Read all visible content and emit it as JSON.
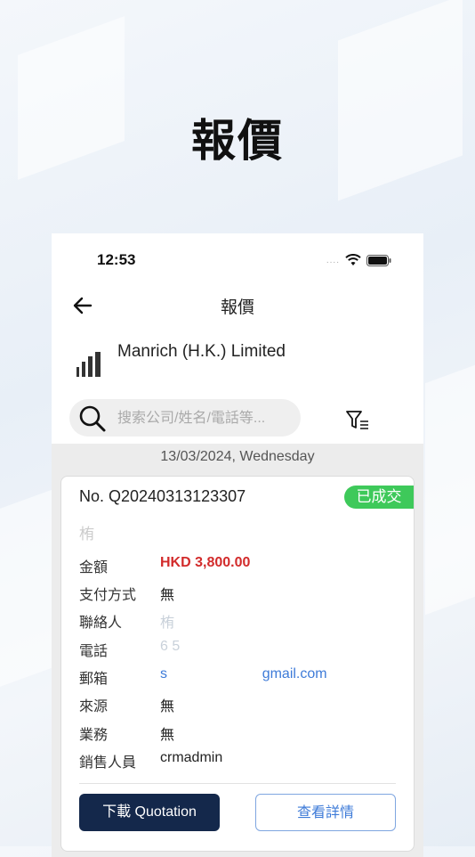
{
  "promo": {
    "title": "報價"
  },
  "status_bar": {
    "time": "12:53",
    "signal": "....",
    "wifi_icon": "wifi-icon",
    "battery_icon": "battery-icon"
  },
  "nav": {
    "back_icon": "arrow-left-icon",
    "title": "報價"
  },
  "company": {
    "logo_icon": "building-chart-icon",
    "name": "Manrich (H.K.) Limited"
  },
  "search": {
    "placeholder": "搜索公司/姓名/電話等...",
    "value": "",
    "filter_icon": "filter-icon"
  },
  "list": {
    "date_header": "13/03/2024, Wednesday",
    "card": {
      "quote_no": "No. Q20240313123307",
      "status": "已成交",
      "customer_name": "栯",
      "fields": [
        {
          "label": "金額",
          "value": "HKD 3,800.00"
        },
        {
          "label": "支付方式",
          "value": "無"
        },
        {
          "label": "聯絡人",
          "value": "栯"
        },
        {
          "label": "電話",
          "value": "6          5"
        },
        {
          "label": "郵箱",
          "value": "s                        gmail.com"
        },
        {
          "label": "來源",
          "value": "無"
        },
        {
          "label": "業務",
          "value": "無"
        },
        {
          "label": "銷售人員",
          "value": "crmadmin"
        }
      ],
      "download_button": "下載 Quotation",
      "detail_button": "查看詳情"
    }
  },
  "colors": {
    "accent": "#14284b",
    "status_green": "#3ec95a",
    "amount_red": "#d22b2b",
    "link_blue": "#3e7bd8"
  }
}
